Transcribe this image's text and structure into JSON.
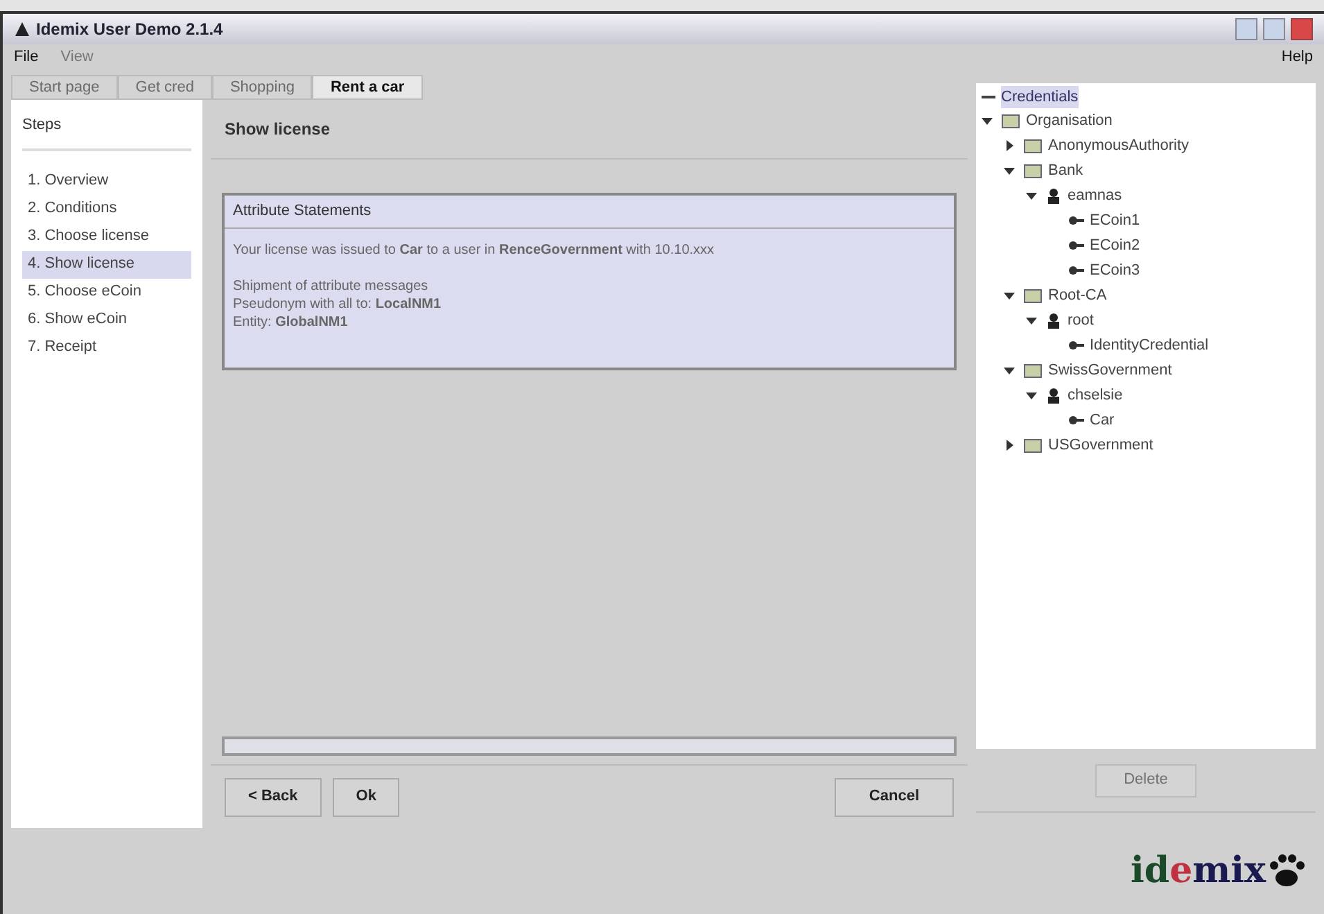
{
  "window": {
    "title": "Idemix User Demo 2.1.4"
  },
  "menu": [
    {
      "label": "File",
      "disabled": false
    },
    {
      "label": "View",
      "disabled": true
    }
  ],
  "help_menu": {
    "label": "Help"
  },
  "tabs": [
    {
      "label": "Start page",
      "selected": false
    },
    {
      "label": "Get cred",
      "selected": false
    },
    {
      "label": "Shopping",
      "selected": false
    },
    {
      "label": "Rent a car",
      "selected": true
    }
  ],
  "steps": {
    "title": "Steps",
    "items": [
      {
        "label": "1. Overview",
        "selected": false
      },
      {
        "label": "2. Conditions",
        "selected": false
      },
      {
        "label": "3. Choose license",
        "selected": false
      },
      {
        "label": "4. Show license",
        "selected": true
      },
      {
        "label": "5. Choose eCoin",
        "selected": false
      },
      {
        "label": "6. Show eCoin",
        "selected": false
      },
      {
        "label": "7. Receipt",
        "selected": false
      }
    ]
  },
  "panel": {
    "title": "Show license",
    "box_title": "Attribute Statements",
    "summary": "Your license was issued to **Car** to a user in **RenceGovernment** with 10.10.xxx",
    "lines": [
      "Shipment of attribute messages",
      "Pseudonym with all to: **LocalNM1**",
      "Entity: **GlobalNM1**"
    ],
    "progress": {
      "level": 0
    }
  },
  "buttons": [
    {
      "label": "< Back",
      "kind": "nav"
    },
    {
      "label": "Ok",
      "kind": "nav"
    },
    {
      "label": "Cancel",
      "kind": "cancel"
    }
  ],
  "tree": {
    "root": "Credentials",
    "items": [
      {
        "label": "Organisation",
        "kind": "org",
        "expanded": true,
        "children": [
          {
            "label": "AnonymousAuthority",
            "kind": "org",
            "expanded": false
          },
          {
            "label": "Bank",
            "kind": "org",
            "expanded": true,
            "children": [
              {
                "label": "eamnas",
                "kind": "user",
                "expanded": true,
                "children": [
                  {
                    "label": "ECoin1",
                    "kind": "cred"
                  },
                  {
                    "label": "ECoin2",
                    "kind": "cred"
                  },
                  {
                    "label": "ECoin3",
                    "kind": "cred"
                  }
                ]
              }
            ]
          },
          {
            "label": "Root-CA",
            "kind": "org",
            "expanded": true,
            "children": [
              {
                "label": "root",
                "kind": "user",
                "expanded": true,
                "children": [
                  {
                    "label": "IdentityCredential",
                    "kind": "cred"
                  }
                ]
              }
            ]
          },
          {
            "label": "SwissGovernment",
            "kind": "org",
            "expanded": true,
            "children": [
              {
                "label": "chselsie",
                "kind": "user",
                "expanded": true,
                "children": [
                  {
                    "label": "Car",
                    "kind": "cred"
                  }
                ]
              }
            ]
          },
          {
            "label": "USGovernment",
            "kind": "org",
            "expanded": false
          }
        ]
      }
    ],
    "button": {
      "label": "Delete",
      "disabled": true
    }
  },
  "logo": {
    "prefix": "id",
    "accent": "e",
    "suffix": "mix"
  }
}
